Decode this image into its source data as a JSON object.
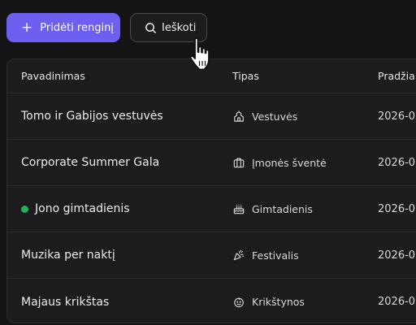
{
  "toolbar": {
    "add_label": "Pridėti renginį",
    "add_icon": "plus-icon",
    "search_label": "Ieškoti",
    "search_icon": "search-icon",
    "accent_color": "#6d5ff0"
  },
  "table": {
    "columns": [
      "Pavadinimas",
      "Tipas",
      "Pradžia"
    ],
    "rows": [
      {
        "name": "Tomo ir Gabijos vestuvės",
        "type": "Vestuvės",
        "type_icon": "chapel-icon",
        "start": "2026-0",
        "status_dot": false
      },
      {
        "name": "Corporate Summer Gala",
        "type": "Įmonės šventė",
        "type_icon": "briefcase-icon",
        "start": "2026-0",
        "status_dot": false
      },
      {
        "name": "Jono gimtadienis",
        "type": "Gimtadienis",
        "type_icon": "cake-icon",
        "start": "2026-0",
        "status_dot": true
      },
      {
        "name": "Muzika per naktį",
        "type": "Festivalis",
        "type_icon": "party-popper-icon",
        "start": "2026-0",
        "status_dot": false
      },
      {
        "name": "Majaus krikštas",
        "type": "Krikštynos",
        "type_icon": "baby-icon",
        "start": "2026-0",
        "status_dot": false
      }
    ],
    "status_dot_color": "#1fb15a"
  }
}
